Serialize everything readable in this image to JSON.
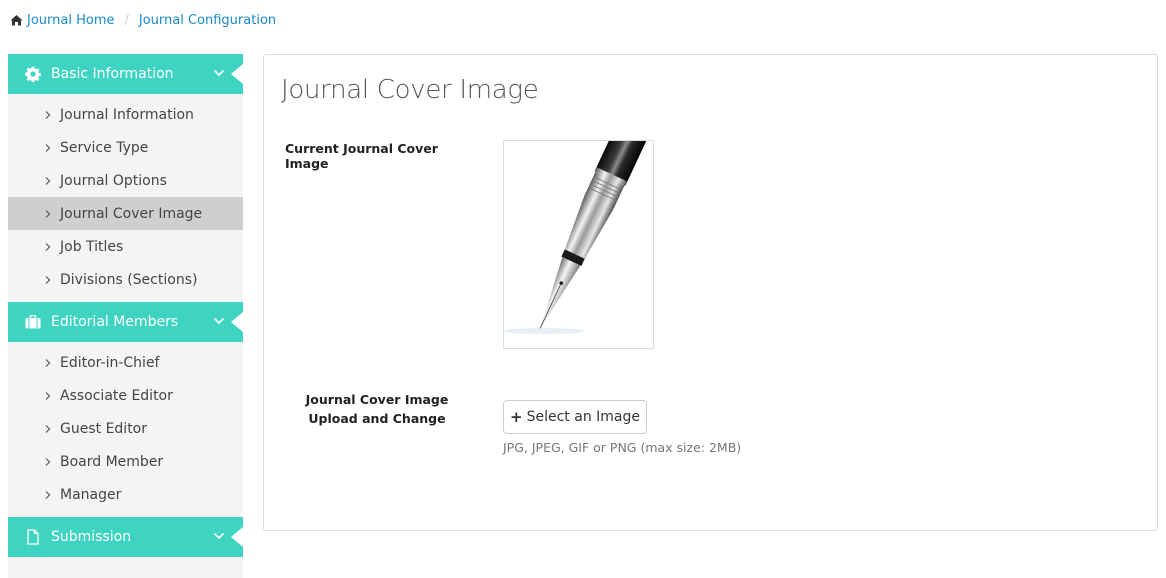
{
  "breadcrumb": {
    "home": "Journal Home",
    "separator": "/",
    "current": "Journal Configuration"
  },
  "colors": {
    "accent": "#3fd4c1",
    "link": "#1a8bc9",
    "active_item": "#cfcfcf"
  },
  "sidebar": {
    "sections": [
      {
        "title": "Basic Information",
        "icon": "gear-icon",
        "items": [
          "Journal Information",
          "Service Type",
          "Journal Options",
          "Journal Cover Image",
          "Job Titles",
          "Divisions (Sections)"
        ]
      },
      {
        "title": "Editorial Members",
        "icon": "briefcase-icon",
        "items": [
          "Editor-in-Chief",
          "Associate Editor",
          "Guest Editor",
          "Board Member",
          "Manager"
        ]
      },
      {
        "title": "Submission",
        "icon": "document-icon",
        "items": []
      }
    ],
    "active_item": "Journal Cover Image"
  },
  "main": {
    "title": "Journal Cover Image",
    "current_label": "Current Journal Cover Image",
    "upload_label_line1": "Journal Cover Image",
    "upload_label_line2": "Upload and Change",
    "button_label": "Select an Image",
    "help_text": "JPG, JPEG, GIF or PNG (max size: 2MB)"
  }
}
